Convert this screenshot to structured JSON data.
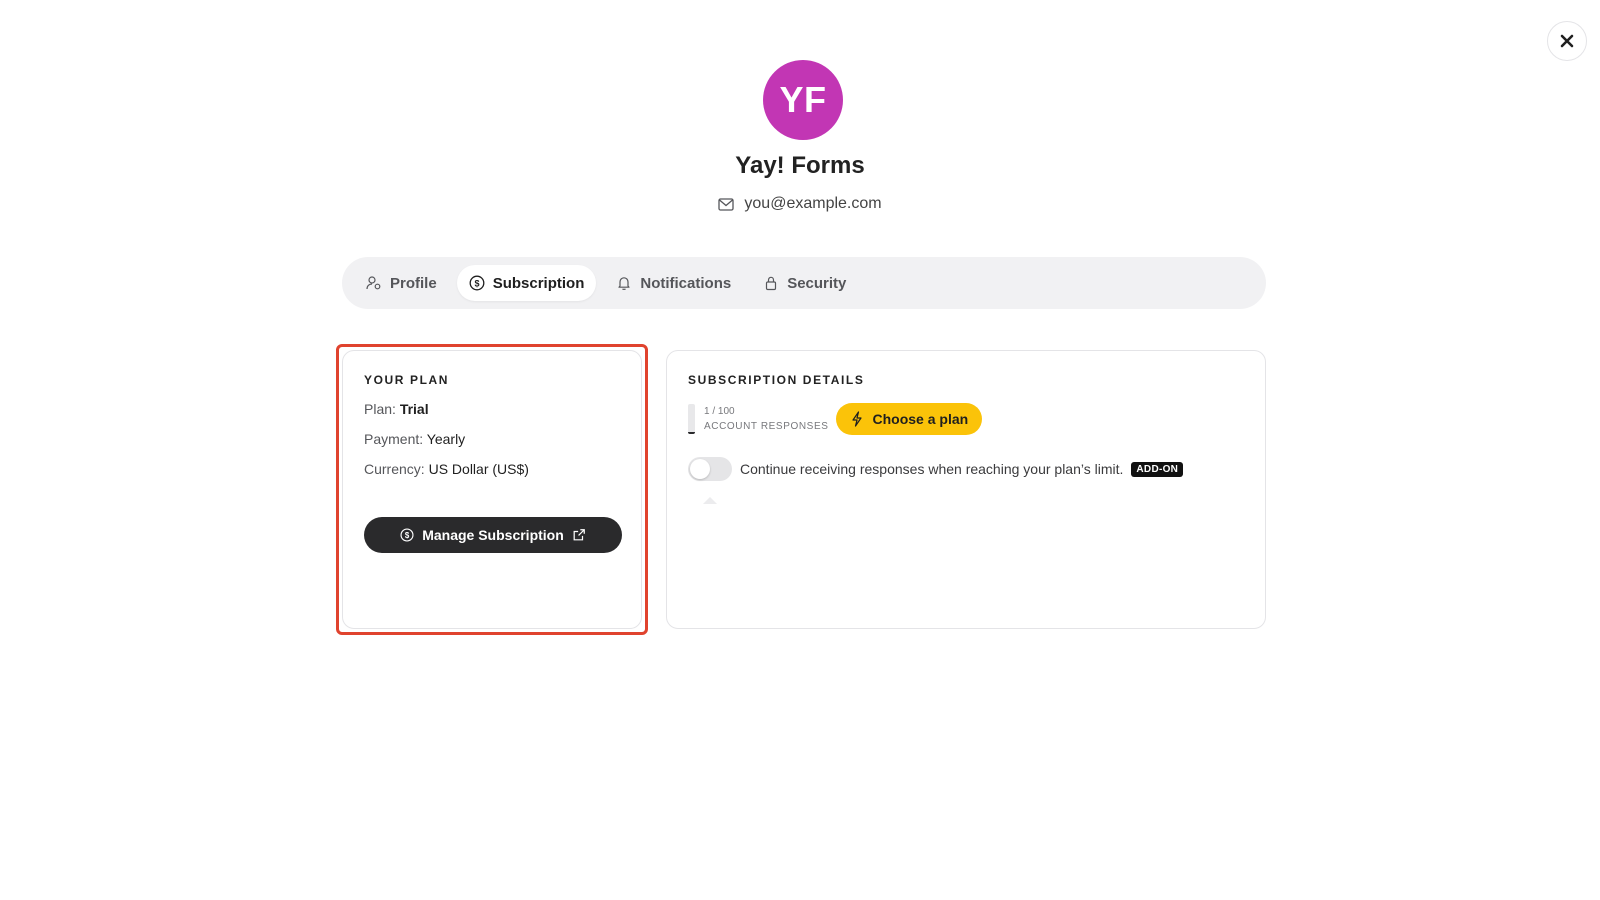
{
  "account": {
    "initials": "YF",
    "avatar_color": "#c236b4",
    "name": "Yay! Forms",
    "email": "you@example.com",
    "email_icon": "mail-icon"
  },
  "close_icon": "close-icon",
  "tabs": [
    {
      "label": "Profile",
      "icon": "user-settings-icon",
      "active": false
    },
    {
      "label": "Subscription",
      "icon": "dollar-circle-icon",
      "active": true
    },
    {
      "label": "Notifications",
      "icon": "bell-icon",
      "active": false
    },
    {
      "label": "Security",
      "icon": "lock-icon",
      "active": false
    }
  ],
  "plan_card": {
    "title": "YOUR PLAN",
    "plan_label": "Plan:",
    "plan_value": "Trial",
    "payment_label": "Payment:",
    "payment_value": "Yearly",
    "currency_label": "Currency:",
    "currency_value": "US Dollar (US$)",
    "manage_button": "Manage Subscription",
    "highlight_color": "#e0432e"
  },
  "details_card": {
    "title": "SUBSCRIPTION DETAILS",
    "usage_count": "1 / 100",
    "usage_label": "ACCOUNT RESPONSES",
    "usage_fraction": 0.01,
    "choose_plan_button": "Choose a plan",
    "choose_plan_color": "#fbc309",
    "toggle_text": "Continue receiving responses when reaching your plan’s limit.",
    "toggle_on": false,
    "addon_badge": "ADD-ON"
  }
}
